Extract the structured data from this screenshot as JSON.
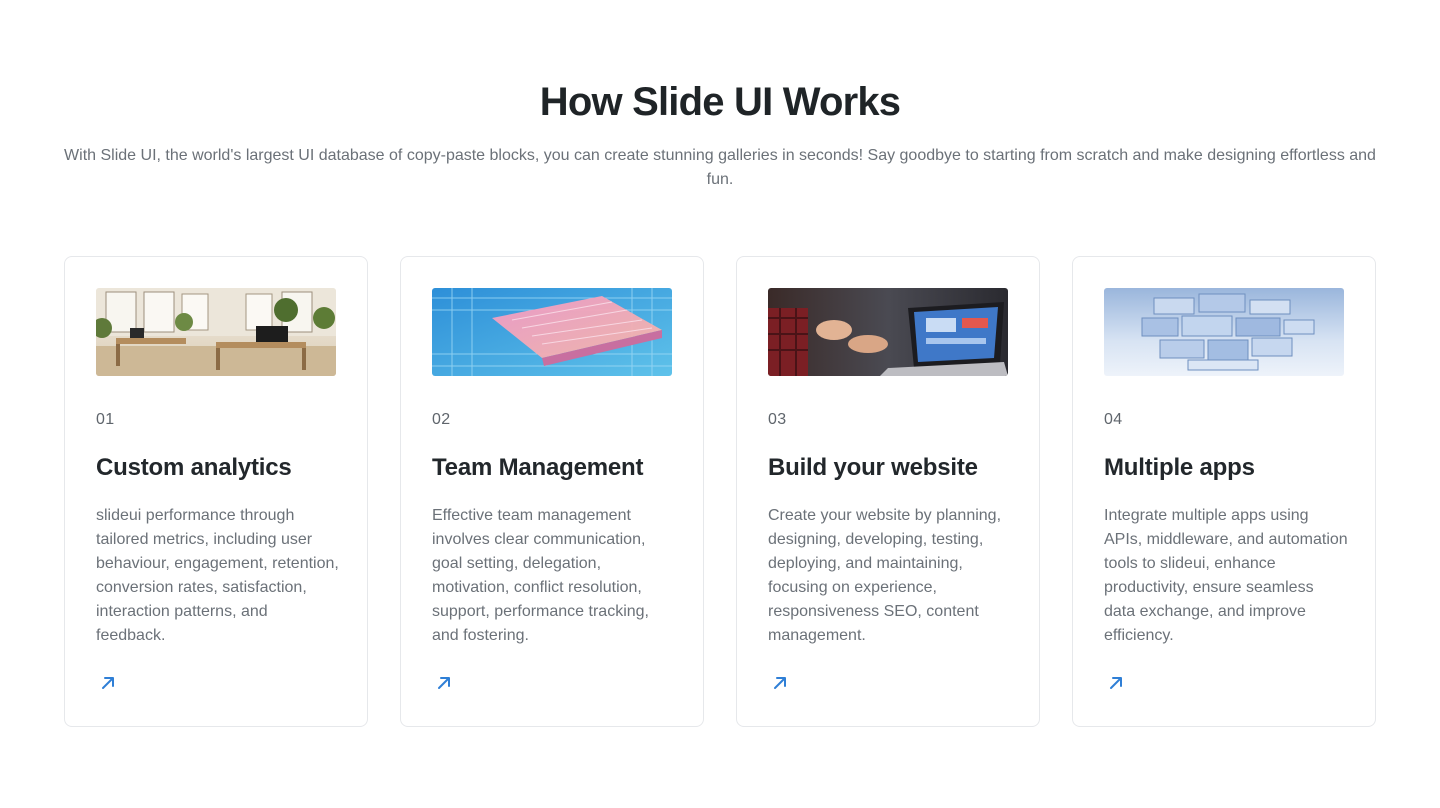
{
  "section": {
    "title": "How Slide UI Works",
    "subtitle": "With Slide UI, the world's largest UI database of copy-paste blocks, you can create stunning galleries in seconds! Say goodbye to starting from scratch and make designing effortless and fun."
  },
  "cards": [
    {
      "number": "01",
      "title": "Custom analytics",
      "description": "slideui performance through tailored metrics, including user behaviour, engagement, retention, conversion rates, satisfaction, interaction patterns, and feedback.",
      "image": "office-workspace-image",
      "link_icon": "arrow-up-right-icon"
    },
    {
      "number": "02",
      "title": "Team Management",
      "description": "Effective team management involves clear communication, goal setting, delegation, motivation, conflict resolution, support, performance tracking, and fostering.",
      "image": "circuit-chip-image",
      "link_icon": "arrow-up-right-icon"
    },
    {
      "number": "03",
      "title": "Build your website",
      "description": "Create your website by planning, designing, developing, testing, deploying, and maintaining, focusing on experience, responsiveness SEO, content management.",
      "image": "laptop-meeting-image",
      "link_icon": "arrow-up-right-icon"
    },
    {
      "number": "04",
      "title": "Multiple apps",
      "description": "Integrate multiple apps using APIs, middleware, and automation tools to slideui, enhance productivity, ensure seamless data exchange, and improve efficiency.",
      "image": "stacked-blocks-image",
      "link_icon": "arrow-up-right-icon"
    }
  ],
  "colors": {
    "accent": "#2f7fd6",
    "heading": "#1f2427",
    "body_text": "#6b7178",
    "card_border": "#e6e8eb"
  }
}
